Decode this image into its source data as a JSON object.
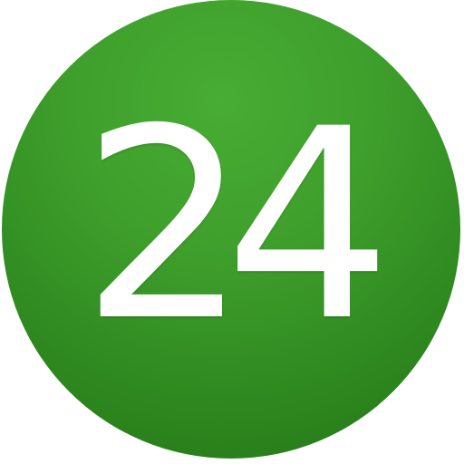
{
  "badge": {
    "value": "24",
    "background_color": "#3c9b2a",
    "text_color": "#ffffff"
  }
}
